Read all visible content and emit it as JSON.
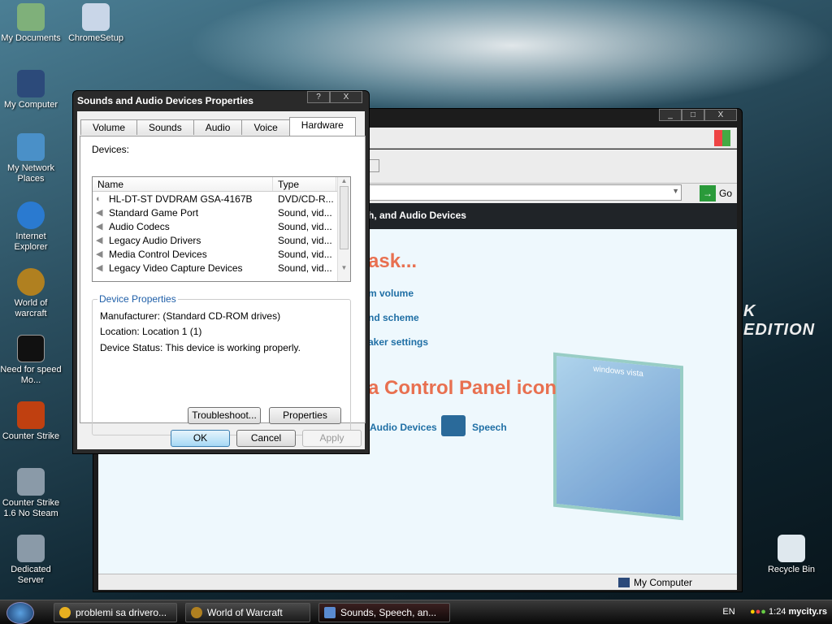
{
  "desktop": {
    "icons": [
      "My Documents",
      "ChromeSetup",
      "My Computer",
      "My Network Places",
      "Internet Explorer",
      "World of warcraft",
      "Need for speed Mo...",
      "Counter Strike",
      "Counter Strike 1.6 No Steam",
      "Dedicated Server",
      "Recycle Bin"
    ],
    "wallpaper_text": "K EDITION"
  },
  "control_panel": {
    "header": "h, and Audio Devices",
    "go_label": "Go",
    "pick_task": "ask...",
    "tasks": [
      "m volume",
      "nd scheme",
      "aker settings"
    ],
    "pick_icon": "a Control Panel icon",
    "icons": [
      "Audio Devices",
      "Speech"
    ],
    "vista_label": "windows vista",
    "status": "My Computer",
    "controls": {
      "min": "_",
      "max": "□",
      "close": "X"
    }
  },
  "dialog": {
    "title": "Sounds and Audio Devices Properties",
    "help": "?",
    "close": "X",
    "tabs": [
      "Volume",
      "Sounds",
      "Audio",
      "Voice",
      "Hardware"
    ],
    "active_tab": "Hardware",
    "devices_label": "Devices:",
    "columns": [
      "Name",
      "Type"
    ],
    "devices": [
      {
        "name": "HL-DT-ST DVDRAM GSA-4167B",
        "type": "DVD/CD-R..."
      },
      {
        "name": "Standard Game Port",
        "type": "Sound, vid..."
      },
      {
        "name": "Audio Codecs",
        "type": "Sound, vid..."
      },
      {
        "name": "Legacy Audio Drivers",
        "type": "Sound, vid..."
      },
      {
        "name": "Media Control Devices",
        "type": "Sound, vid..."
      },
      {
        "name": "Legacy Video Capture Devices",
        "type": "Sound, vid..."
      }
    ],
    "props_group": "Device Properties",
    "manufacturer": "Manufacturer: (Standard CD-ROM drives)",
    "location": "Location: Location 1 (1)",
    "status": "Device Status: This device is working properly.",
    "troubleshoot": "Troubleshoot...",
    "properties": "Properties",
    "ok": "OK",
    "cancel": "Cancel",
    "apply": "Apply"
  },
  "taskbar": {
    "tasks": [
      "problemi sa drivero...",
      "World of Warcraft",
      "Sounds, Speech, an..."
    ],
    "lang": "EN",
    "clock": "1:24",
    "watermark": "mycity.rs"
  }
}
